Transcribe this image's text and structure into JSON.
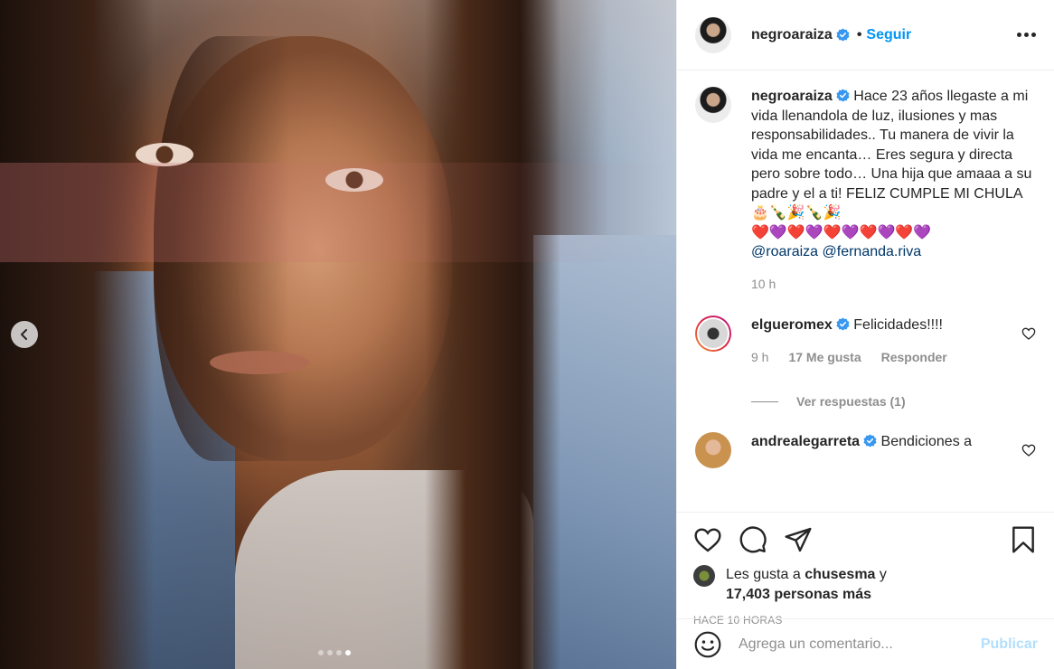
{
  "post": {
    "username": "negroaraiza",
    "follow_label": "Seguir",
    "separator": "•",
    "caption_parts": [
      "Hace 23 años llegaste a mi vida llenandola de luz, ilusiones y mas responsabilidades.. Tu manera de vivir la vida me encanta… Eres segura y directa pero sobre todo… Una hija que amaaa a su padre y el a ti! FELIZ CUMPLE MI CHULA 🎂🍾🎉🍾🎉",
      "❤️💜❤️💜❤️💜❤️💜❤️💜"
    ],
    "mentions": [
      "@roaraiza",
      "@fernanda.riva"
    ],
    "caption_time": "10 h",
    "carousel": {
      "total": 4,
      "active_index": 4
    }
  },
  "comments": [
    {
      "username": "elgueromex",
      "text": "Felicidades!!!!",
      "time": "9 h",
      "likes": "17 Me gusta",
      "reply_label": "Responder",
      "view_replies": "Ver respuestas (1)"
    },
    {
      "username": "andrealegarreta",
      "text": "Bendiciones a"
    }
  ],
  "likes": {
    "prefix": "Les gusta a",
    "user": "chusesma",
    "conj": "y",
    "others": "17,403 personas más"
  },
  "timestamp": "HACE 10 HORAS",
  "add_comment": {
    "placeholder": "Agrega un comentario...",
    "publish_label": "Publicar"
  },
  "icons": {
    "verified": "verified-badge-icon",
    "like": "heart-icon",
    "comment": "comment-bubble-icon",
    "share": "paper-plane-icon",
    "save": "bookmark-icon",
    "emoji": "smiley-icon",
    "more": "ellipsis-icon",
    "prev": "chevron-left-icon"
  },
  "colors": {
    "accent": "#0095f6",
    "muted": "#8e8e8e",
    "publish_disabled": "#b2dffc",
    "mention": "#00376b"
  }
}
